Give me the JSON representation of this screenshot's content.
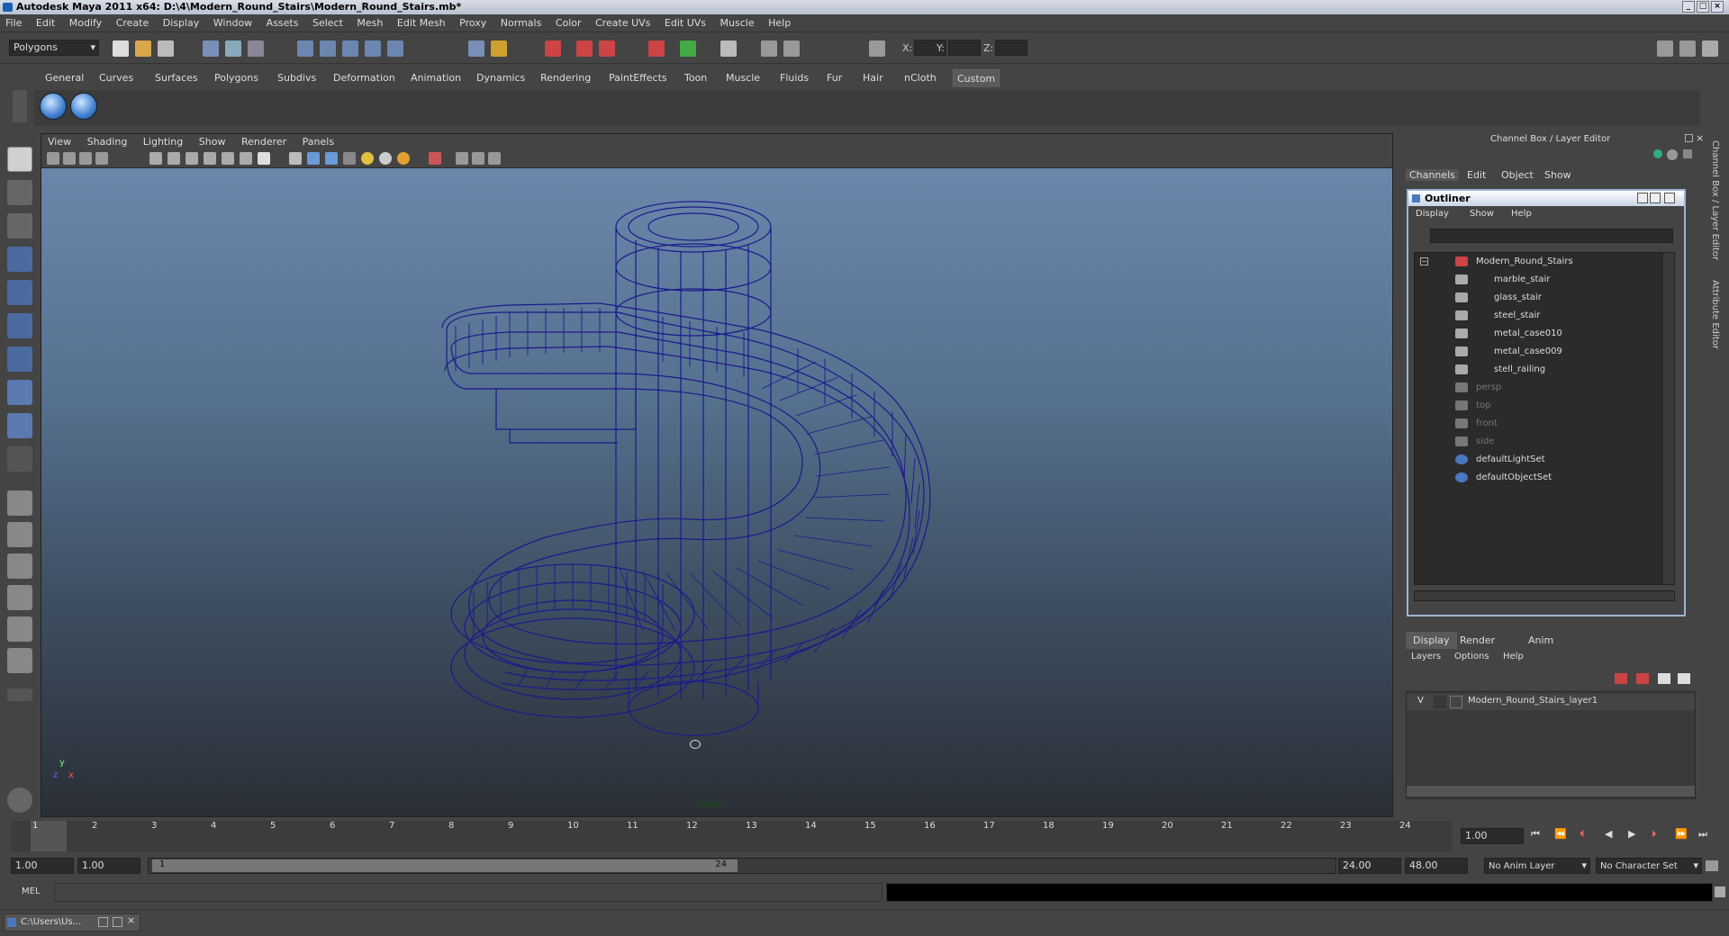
{
  "window": {
    "title": "Autodesk Maya 2011 x64: D:\\4\\Modern_Round_Stairs\\Modern_Round_Stairs.mb*"
  },
  "menu": [
    "File",
    "Edit",
    "Modify",
    "Create",
    "Display",
    "Window",
    "Assets",
    "Select",
    "Mesh",
    "Edit Mesh",
    "Proxy",
    "Normals",
    "Color",
    "Create UVs",
    "Edit UVs",
    "Muscle",
    "Help"
  ],
  "status_line": {
    "mode": "Polygons",
    "x_label": "X:",
    "y_label": "Y:",
    "z_label": "Z:"
  },
  "shelf_tabs": [
    "General",
    "Curves",
    "Surfaces",
    "Polygons",
    "Subdivs",
    "Deformation",
    "Animation",
    "Dynamics",
    "Rendering",
    "PaintEffects",
    "Toon",
    "Muscle",
    "Fluids",
    "Fur",
    "Hair",
    "nCloth",
    "Custom"
  ],
  "shelf_active": "Custom",
  "viewport": {
    "menu": [
      "View",
      "Shading",
      "Lighting",
      "Show",
      "Renderer",
      "Panels"
    ],
    "camera": "persp",
    "axis_y": "y",
    "axis_x": "x",
    "axis_z": "z"
  },
  "channel_box": {
    "title": "Channel Box / Layer Editor",
    "menu": [
      "Channels",
      "Edit",
      "Object",
      "Show"
    ]
  },
  "outliner": {
    "title": "Outliner",
    "menu": [
      "Display",
      "Show",
      "Help"
    ],
    "root": "Modern_Round_Stairs",
    "children": [
      "marble_stair",
      "glass_stair",
      "steel_stair",
      "metal_case010",
      "metal_case009",
      "stell_railing"
    ],
    "cameras": [
      "persp",
      "top",
      "front",
      "side"
    ],
    "sets": [
      "defaultLightSet",
      "defaultObjectSet"
    ]
  },
  "layer_editor": {
    "tabs": [
      "Display",
      "Render",
      "Anim"
    ],
    "menu": [
      "Layers",
      "Options",
      "Help"
    ],
    "layer_visibility": "V",
    "layer_name": "Modern_Round_Stairs_layer1"
  },
  "side_tabs": [
    "Channel Box / Layer Editor",
    "Attribute Editor"
  ],
  "timeline": {
    "ticks": [
      "1",
      "2",
      "3",
      "4",
      "5",
      "6",
      "7",
      "8",
      "9",
      "10",
      "11",
      "12",
      "13",
      "14",
      "15",
      "16",
      "17",
      "18",
      "19",
      "20",
      "21",
      "22",
      "23",
      "24"
    ],
    "current_frame": "1.00"
  },
  "range": {
    "start": "1.00",
    "playback_start": "1.00",
    "slider_start": "1",
    "slider_end": "24",
    "playback_end": "24.00",
    "end": "48.00",
    "anim_layer": "No Anim Layer",
    "character_set": "No Character Set"
  },
  "command_line": {
    "label": "MEL"
  },
  "taskbar": {
    "item": "C:\\Users\\Us..."
  }
}
